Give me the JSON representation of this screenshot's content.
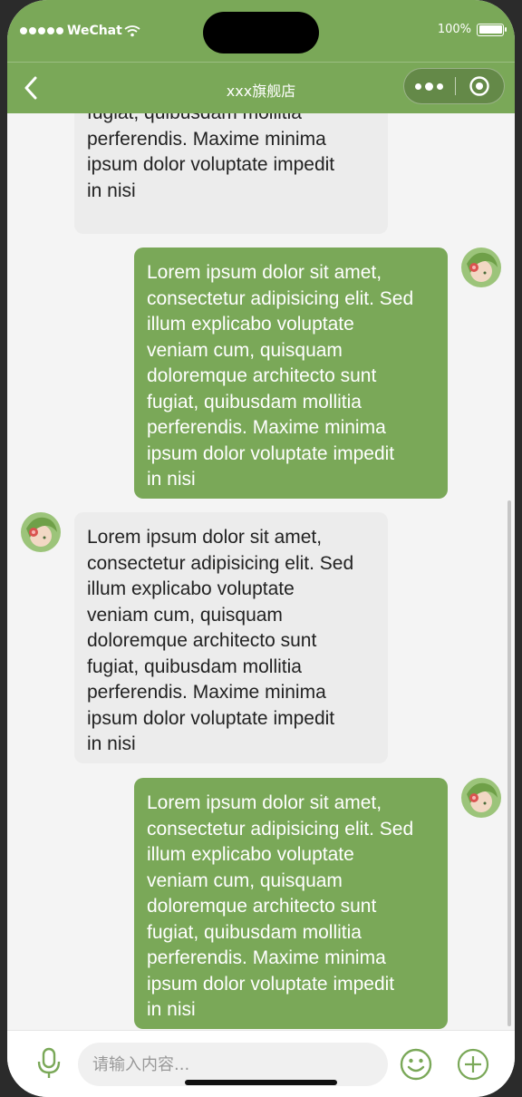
{
  "status_bar": {
    "carrier": "WeChat",
    "battery": "100%"
  },
  "nav": {
    "title": "xxx旗舰店",
    "icons": {
      "back": "chevron-left-icon",
      "more": "more-dots-icon",
      "close": "target-icon"
    }
  },
  "colors": {
    "accent": "#7aa858",
    "left_bubble": "#ececec",
    "background": "#f4f4f4"
  },
  "messages": [
    {
      "side": "left",
      "lines": [
        "fugiat, quibusdam mollitia",
        "perferendis. Maxime minima",
        "ipsum dolor voluptate impedit",
        "in nisi"
      ],
      "partial": true
    },
    {
      "side": "right",
      "lines": [
        "Lorem ipsum dolor sit amet,",
        "consectetur adipisicing elit. Sed",
        "illum explicabo voluptate",
        "veniam cum, quisquam",
        "doloremque architecto sunt",
        "fugiat, quibusdam mollitia",
        "perferendis. Maxime minima",
        "ipsum dolor voluptate impedit",
        "in nisi"
      ]
    },
    {
      "side": "left",
      "lines": [
        "Lorem ipsum dolor sit amet,",
        "consectetur adipisicing elit. Sed",
        "illum explicabo voluptate",
        "veniam cum, quisquam",
        "doloremque architecto sunt",
        "fugiat, quibusdam mollitia",
        "perferendis. Maxime minima",
        "ipsum dolor voluptate impedit",
        "in nisi"
      ]
    },
    {
      "side": "right",
      "lines": [
        "Lorem ipsum dolor sit amet,",
        "consectetur adipisicing elit. Sed",
        "illum explicabo voluptate",
        "veniam cum, quisquam",
        "doloremque architecto sunt",
        "fugiat, quibusdam mollitia",
        "perferendis. Maxime minima",
        "ipsum dolor voluptate impedit",
        "in nisi"
      ]
    }
  ],
  "input_bar": {
    "placeholder": "请输入内容...",
    "value": "",
    "icons": {
      "voice": "microphone-icon",
      "emoji": "smiley-icon",
      "add": "plus-circle-icon"
    }
  }
}
